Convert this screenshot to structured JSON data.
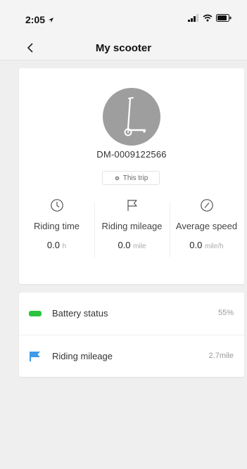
{
  "status_bar": {
    "time": "2:05"
  },
  "nav": {
    "title": "My scooter"
  },
  "device": {
    "id": "DM-0009122566",
    "trip_chip_label": "This trip"
  },
  "stats": [
    {
      "label": "Riding time",
      "value": "0.0",
      "unit": "h",
      "icon": "clock-icon"
    },
    {
      "label": "Riding mileage",
      "value": "0.0",
      "unit": "mile",
      "icon": "flag-icon"
    },
    {
      "label": "Average speed",
      "value": "0.0",
      "unit": "mile/h",
      "icon": "speedometer-icon"
    }
  ],
  "list": [
    {
      "label": "Battery status",
      "value": "55%",
      "icon": "battery-icon",
      "color": "#2cc43f"
    },
    {
      "label": "Riding mileage",
      "value": "2.7mile",
      "icon": "flag-icon",
      "color": "#3d9be9"
    }
  ]
}
